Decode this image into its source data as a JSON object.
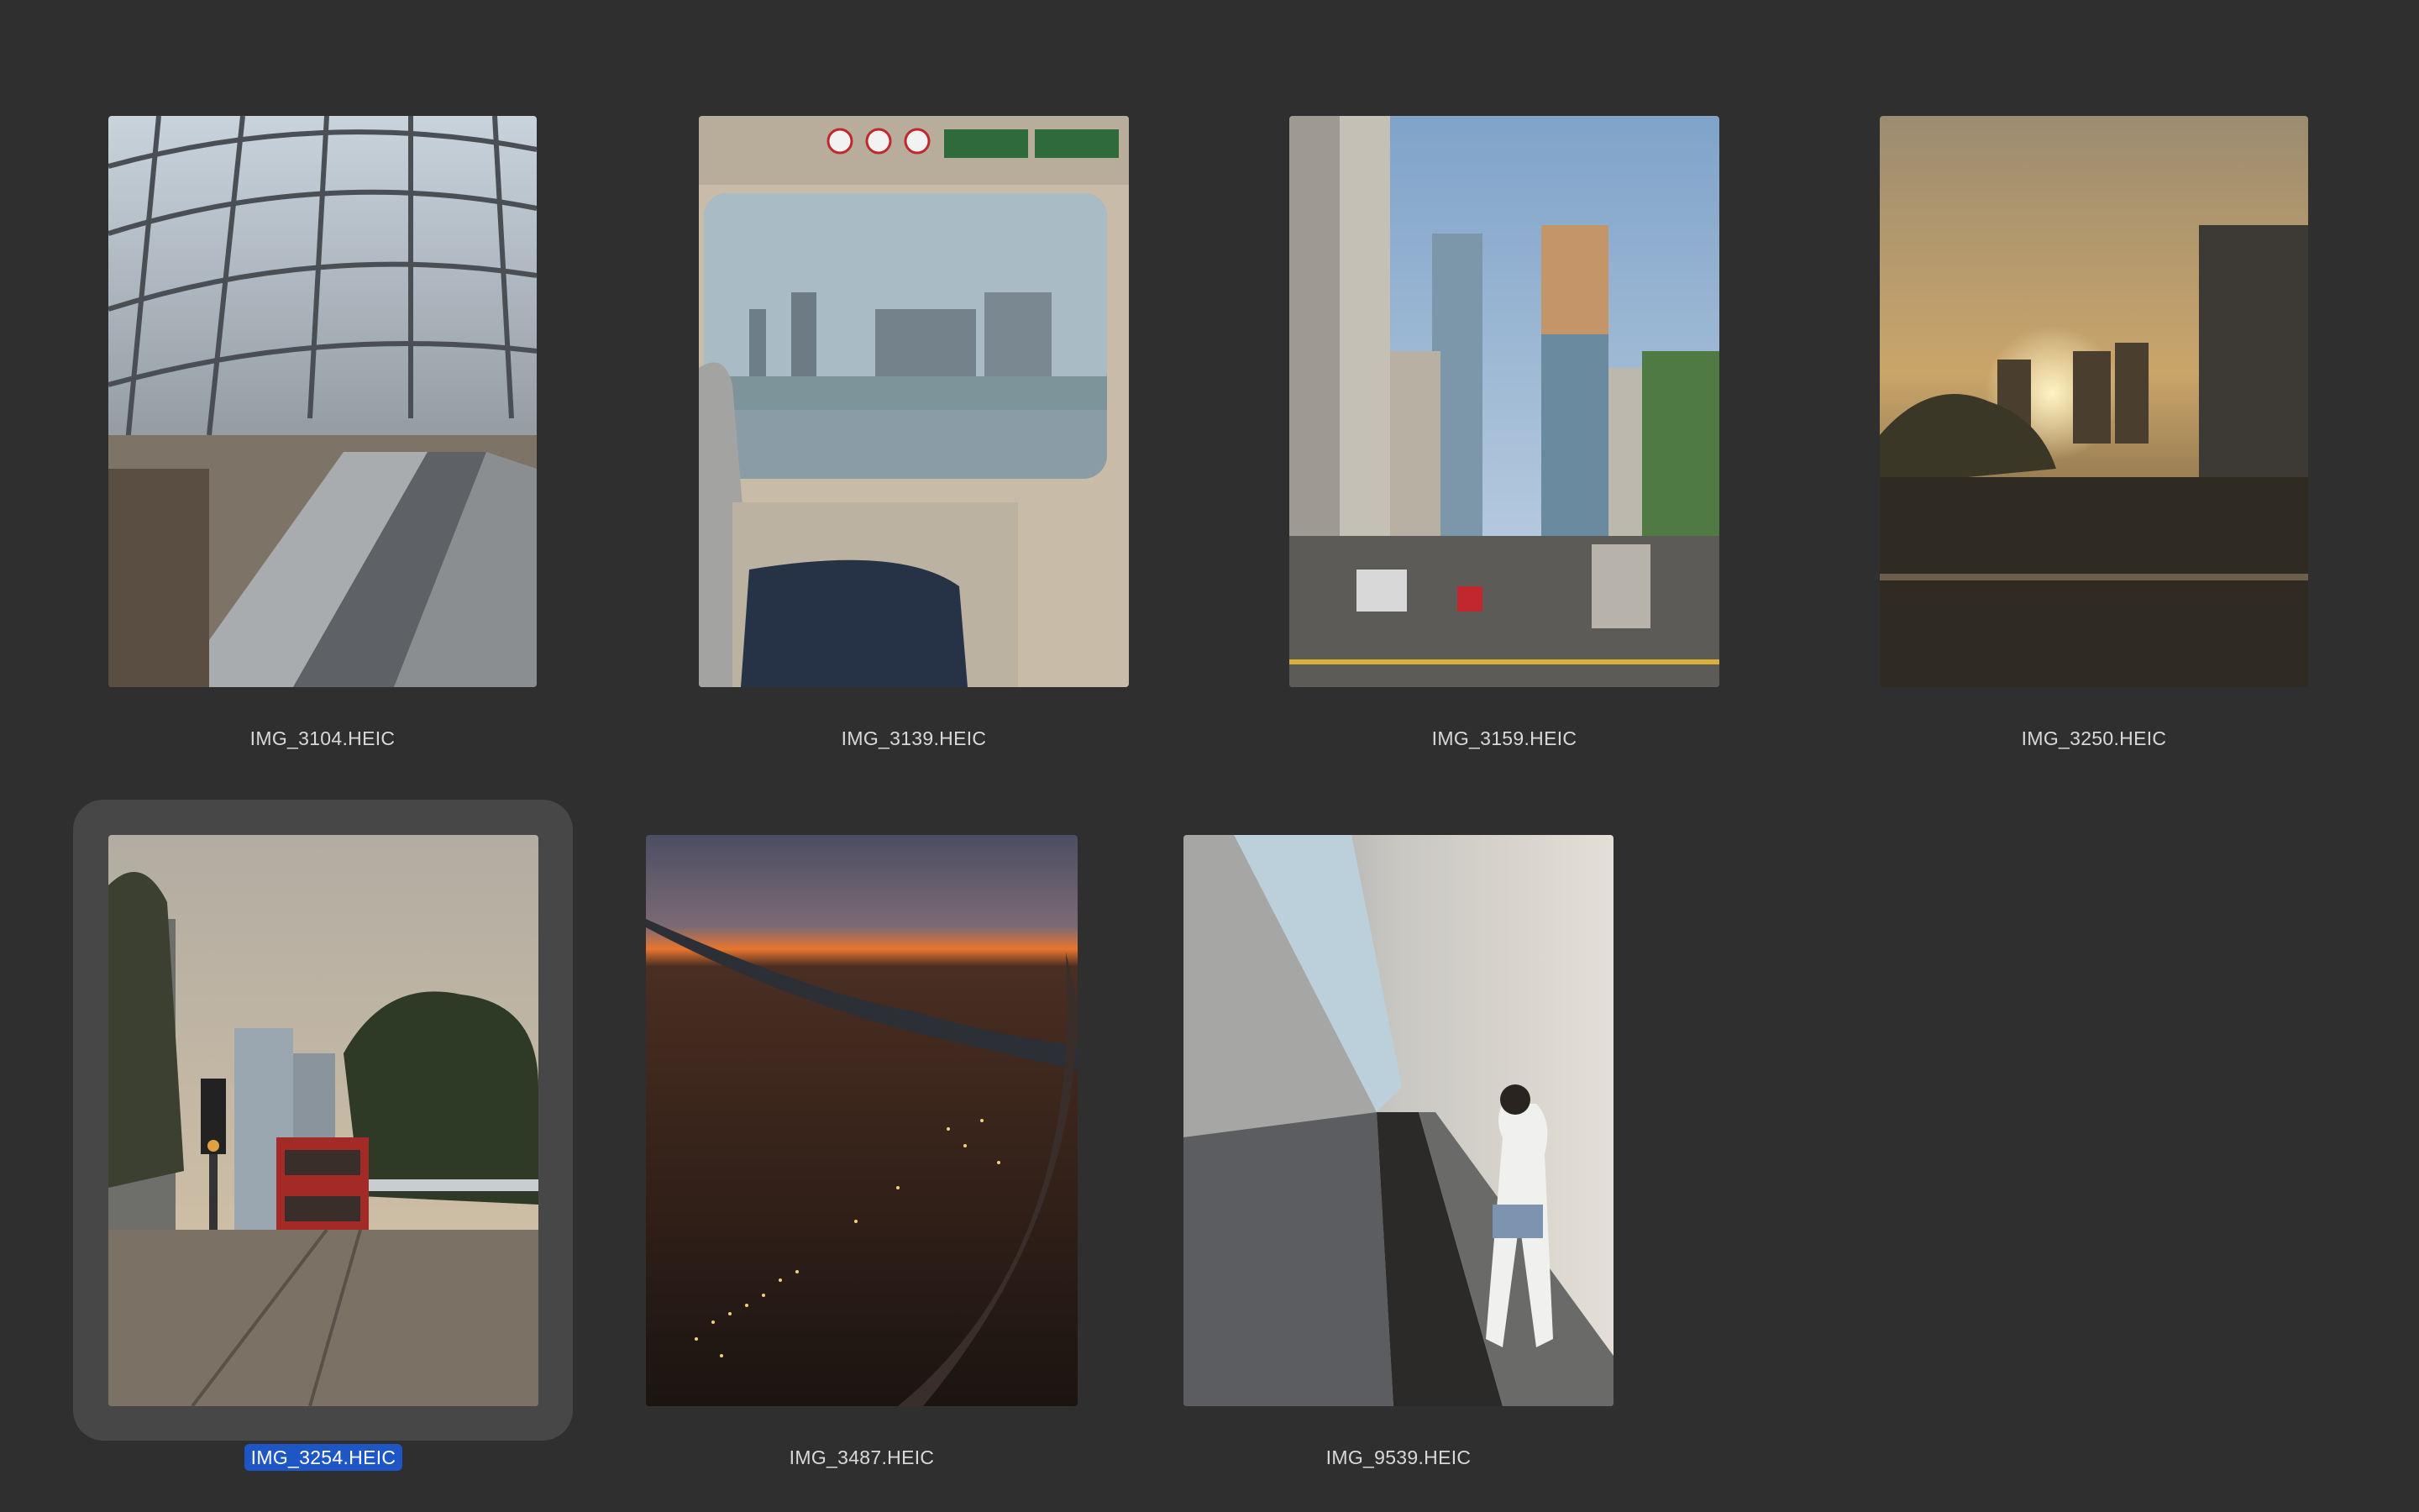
{
  "window": {
    "title": "",
    "background_color": "#2f2f2f",
    "selection_color": "#1f56c6"
  },
  "files": [
    {
      "name": "IMG_3104.HEIC",
      "selected": false,
      "icon": "photo-thumbnail-station-escalators"
    },
    {
      "name": "IMG_3139.HEIC",
      "selected": false,
      "icon": "photo-thumbnail-train-window"
    },
    {
      "name": "IMG_3159.HEIC",
      "selected": false,
      "icon": "photo-thumbnail-city-street"
    },
    {
      "name": "IMG_3250.HEIC",
      "selected": false,
      "icon": "photo-thumbnail-sunset-skyline"
    },
    {
      "name": "IMG_3254.HEIC",
      "selected": true,
      "icon": "photo-thumbnail-tram-street"
    },
    {
      "name": "IMG_3487.HEIC",
      "selected": false,
      "icon": "photo-thumbnail-airplane-wing"
    },
    {
      "name": "IMG_9539.HEIC",
      "selected": false,
      "icon": "photo-thumbnail-travelator"
    }
  ]
}
